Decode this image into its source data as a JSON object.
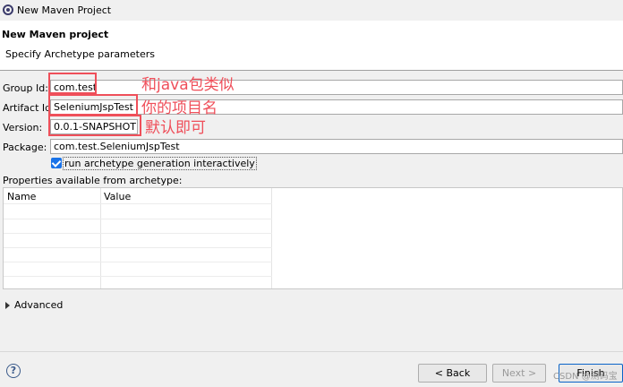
{
  "window": {
    "title": "New Maven Project"
  },
  "header": {
    "title": "New Maven project",
    "subtitle": "Specify Archetype parameters"
  },
  "form": {
    "group_id": {
      "label": "Group Id:",
      "value": "com.test"
    },
    "artifact_id": {
      "label": "Artifact Id:",
      "value": "SeleniumJspTest"
    },
    "version": {
      "label": "Version:",
      "value": "0.0.1-SNAPSHOT"
    },
    "package": {
      "label": "Package:",
      "value": "com.test.SeleniumJspTest"
    },
    "interactive": {
      "label": "run archetype generation interactively",
      "checked": true
    }
  },
  "properties": {
    "label": "Properties available from archetype:",
    "columns": [
      "Name",
      "Value"
    ],
    "rows": []
  },
  "advanced": {
    "label": "Advanced"
  },
  "buttons": {
    "help": "?",
    "back": "< Back",
    "next": "Next >",
    "finish": "Finish"
  },
  "annotations": {
    "group_note": "和java包类似",
    "artifact_note": "你的项目名",
    "version_note": "默认即可",
    "color": "#ef4f5a"
  },
  "watermark": "CSDN @测码宝"
}
